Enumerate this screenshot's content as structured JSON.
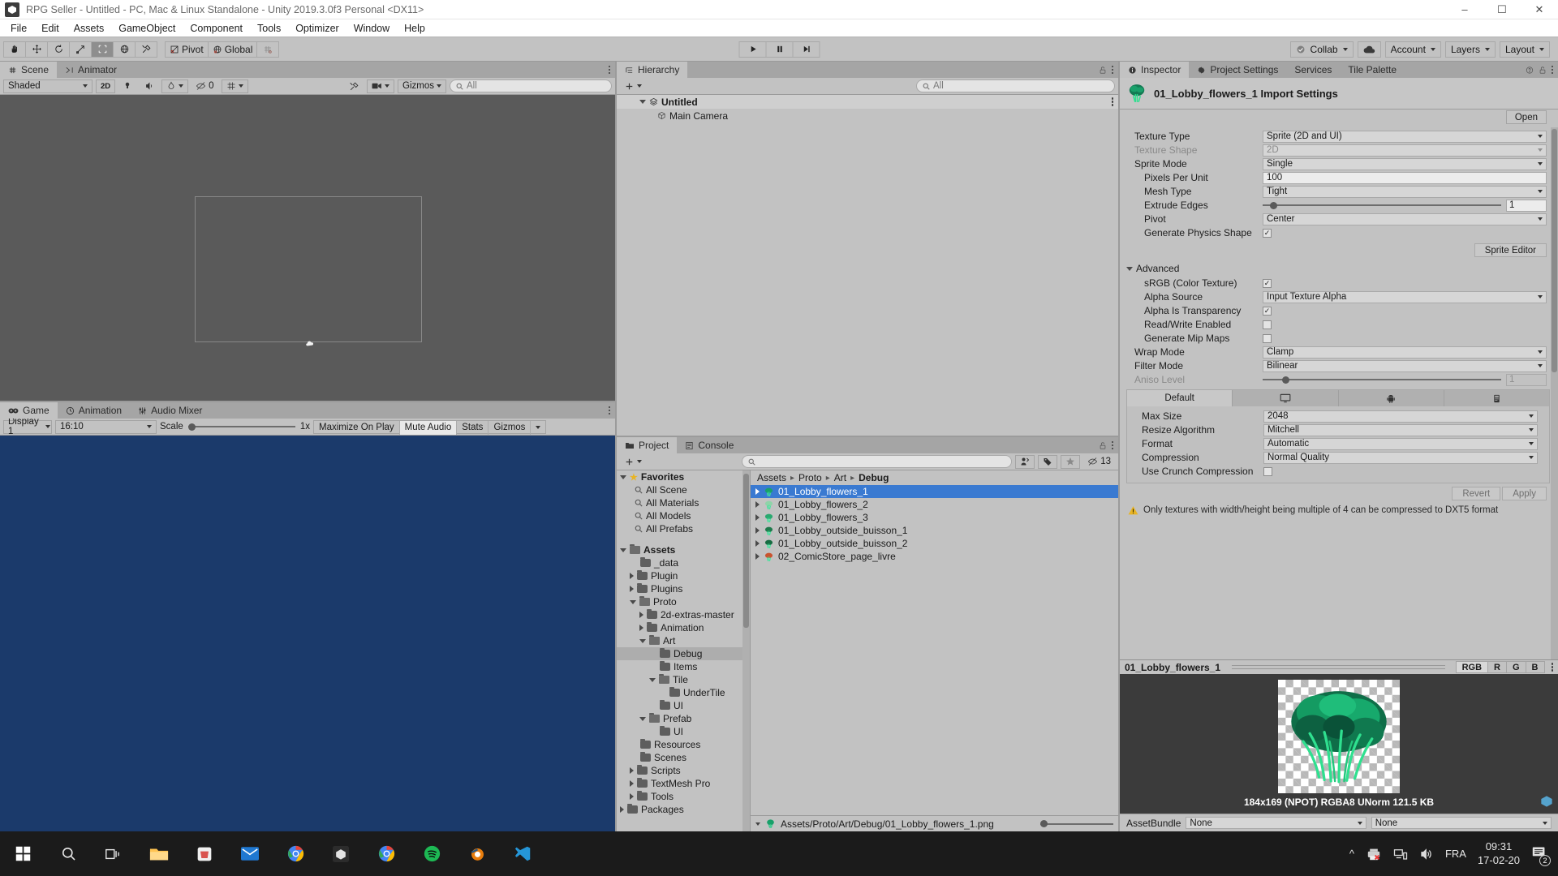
{
  "window": {
    "title": "RPG Seller - Untitled - PC, Mac & Linux Standalone - Unity 2019.3.0f3 Personal <DX11>",
    "minimize": "–",
    "maximize": "☐",
    "close": "✕"
  },
  "menubar": [
    "File",
    "Edit",
    "Assets",
    "GameObject",
    "Component",
    "Tools",
    "Optimizer",
    "Window",
    "Help"
  ],
  "toolbar": {
    "tools": [
      "hand-tool",
      "move-tool",
      "rotate-tool",
      "scale-tool",
      "rect-tool",
      "transform-tool",
      "custom-tool"
    ],
    "pivot_label": "Pivot",
    "global_label": "Global",
    "play": "▶",
    "pause": "❙❙",
    "step": "▶❙",
    "collab_label": "Collab",
    "account_label": "Account",
    "layers_label": "Layers",
    "layout_label": "Layout"
  },
  "scene": {
    "tabs": [
      {
        "label": "Scene",
        "icon": "grid-icon",
        "active": true
      },
      {
        "label": "Animator",
        "icon": "animator-icon",
        "active": false
      }
    ],
    "draw_mode": "Shaded",
    "mode_2d": "2D",
    "hidden_count": "0",
    "gizmos_label": "Gizmos",
    "search_placeholder": "All"
  },
  "game": {
    "tabs": [
      {
        "label": "Game",
        "icon": "game-icon",
        "active": true
      },
      {
        "label": "Animation",
        "icon": "clock-icon",
        "active": false
      },
      {
        "label": "Audio Mixer",
        "icon": "mixer-icon",
        "active": false
      }
    ],
    "display": "Display 1",
    "aspect": "16:10",
    "scale_label": "Scale",
    "scale_value": "1x",
    "maximize_label": "Maximize On Play",
    "mute_label": "Mute Audio",
    "stats_label": "Stats",
    "gizmos_label": "Gizmos"
  },
  "hierarchy": {
    "tab_label": "Hierarchy",
    "search_placeholder": "All",
    "items": [
      {
        "label": "Untitled",
        "type": "scene",
        "depth": 0
      },
      {
        "label": "Main Camera",
        "type": "gameobject",
        "depth": 1
      }
    ]
  },
  "project": {
    "tabs": [
      {
        "label": "Project",
        "icon": "folder-icon",
        "active": true
      },
      {
        "label": "Console",
        "icon": "console-icon",
        "active": false
      }
    ],
    "search_placeholder": "",
    "hidden_count": "13",
    "favorites_label": "Favorites",
    "favorites": [
      "All Scene",
      "All Materials",
      "All Models",
      "All Prefabs"
    ],
    "assets_label": "Assets",
    "tree": [
      {
        "label": "_data",
        "depth": 1,
        "arrow": "none",
        "open": false
      },
      {
        "label": "Plugin",
        "depth": 1,
        "arrow": "closed",
        "open": false
      },
      {
        "label": "Plugins",
        "depth": 1,
        "arrow": "closed",
        "open": false
      },
      {
        "label": "Proto",
        "depth": 1,
        "arrow": "open",
        "open": true
      },
      {
        "label": "2d-extras-master",
        "depth": 2,
        "arrow": "closed",
        "open": false
      },
      {
        "label": "Animation",
        "depth": 2,
        "arrow": "closed",
        "open": false
      },
      {
        "label": "Art",
        "depth": 2,
        "arrow": "open",
        "open": true
      },
      {
        "label": "Debug",
        "depth": 3,
        "arrow": "none",
        "open": false,
        "selected": true
      },
      {
        "label": "Items",
        "depth": 3,
        "arrow": "none",
        "open": false
      },
      {
        "label": "Tile",
        "depth": 3,
        "arrow": "open",
        "open": true
      },
      {
        "label": "UnderTile",
        "depth": 4,
        "arrow": "none",
        "open": false
      },
      {
        "label": "UI",
        "depth": 3,
        "arrow": "none",
        "open": false
      },
      {
        "label": "Prefab",
        "depth": 2,
        "arrow": "open",
        "open": true
      },
      {
        "label": "UI",
        "depth": 3,
        "arrow": "none",
        "open": false
      },
      {
        "label": "Resources",
        "depth": 1,
        "arrow": "none",
        "open": false
      },
      {
        "label": "Scenes",
        "depth": 1,
        "arrow": "none",
        "open": false
      },
      {
        "label": "Scripts",
        "depth": 1,
        "arrow": "closed",
        "open": false
      },
      {
        "label": "TextMesh Pro",
        "depth": 1,
        "arrow": "closed",
        "open": false
      },
      {
        "label": "Tools",
        "depth": 1,
        "arrow": "closed",
        "open": false
      },
      {
        "label": "Packages",
        "depth": 0,
        "arrow": "closed",
        "open": false
      }
    ],
    "breadcrumb": [
      "Assets",
      "Proto",
      "Art",
      "Debug"
    ],
    "files": [
      {
        "name": "01_Lobby_flowers_1",
        "selected": true
      },
      {
        "name": "01_Lobby_flowers_2",
        "selected": false
      },
      {
        "name": "01_Lobby_flowers_3",
        "selected": false
      },
      {
        "name": "01_Lobby_outside_buisson_1",
        "selected": false
      },
      {
        "name": "01_Lobby_outside_buisson_2",
        "selected": false
      },
      {
        "name": "02_ComicStore_page_livre",
        "selected": false
      }
    ],
    "status_path": "Assets/Proto/Art/Debug/01_Lobby_flowers_1.png"
  },
  "inspector": {
    "tabs": [
      {
        "label": "Inspector",
        "icon": "info-icon",
        "active": true
      },
      {
        "label": "Project Settings",
        "icon": "gear-icon",
        "active": false
      },
      {
        "label": "Services",
        "icon": "none",
        "active": false
      },
      {
        "label": "Tile Palette",
        "icon": "none",
        "active": false
      }
    ],
    "title": "01_Lobby_flowers_1 Import Settings",
    "open_label": "Open",
    "fields": [
      {
        "label": "Texture Type",
        "value": "Sprite (2D and UI)",
        "type": "dropdown",
        "indent": 0,
        "dim": false
      },
      {
        "label": "Texture Shape",
        "value": "2D",
        "type": "dropdown",
        "indent": 0,
        "dim": true
      },
      {
        "label": "Sprite Mode",
        "value": "Single",
        "type": "dropdown",
        "indent": 0,
        "dim": false
      },
      {
        "label": "Pixels Per Unit",
        "value": "100",
        "type": "input",
        "indent": 1,
        "dim": false
      },
      {
        "label": "Mesh Type",
        "value": "Tight",
        "type": "dropdown",
        "indent": 1,
        "dim": false
      },
      {
        "label": "Extrude Edges",
        "value": "1",
        "type": "slider",
        "indent": 1,
        "dim": false,
        "pct": 3
      },
      {
        "label": "Pivot",
        "value": "Center",
        "type": "dropdown",
        "indent": 1,
        "dim": false
      },
      {
        "label": "Generate Physics Shape",
        "value": "checked",
        "type": "checkbox",
        "indent": 1,
        "dim": false
      }
    ],
    "sprite_editor_label": "Sprite Editor",
    "advanced_label": "Advanced",
    "advanced_fields": [
      {
        "label": "sRGB (Color Texture)",
        "value": "checked",
        "type": "checkbox",
        "indent": 1,
        "dim": false
      },
      {
        "label": "Alpha Source",
        "value": "Input Texture Alpha",
        "type": "dropdown",
        "indent": 1,
        "dim": false
      },
      {
        "label": "Alpha Is Transparency",
        "value": "checked",
        "type": "checkbox",
        "indent": 1,
        "dim": false
      },
      {
        "label": "Read/Write Enabled",
        "value": "unchecked",
        "type": "checkbox",
        "indent": 1,
        "dim": false
      },
      {
        "label": "Generate Mip Maps",
        "value": "unchecked",
        "type": "checkbox",
        "indent": 1,
        "dim": false
      },
      {
        "label": "Wrap Mode",
        "value": "Clamp",
        "type": "dropdown",
        "indent": 0,
        "dim": false
      },
      {
        "label": "Filter Mode",
        "value": "Bilinear",
        "type": "dropdown",
        "indent": 0,
        "dim": false
      },
      {
        "label": "Aniso Level",
        "value": "1",
        "type": "slider",
        "indent": 0,
        "dim": true,
        "pct": 8
      }
    ],
    "platform_tabs": [
      {
        "label": "Default",
        "icon": "none",
        "active": true
      },
      {
        "label": "",
        "icon": "standalone-icon",
        "active": false
      },
      {
        "label": "",
        "icon": "android-icon",
        "active": false
      },
      {
        "label": "",
        "icon": "webgl-icon",
        "active": false
      }
    ],
    "platform_fields": [
      {
        "label": "Max Size",
        "value": "2048",
        "type": "dropdown"
      },
      {
        "label": "Resize Algorithm",
        "value": "Mitchell",
        "type": "dropdown"
      },
      {
        "label": "Format",
        "value": "Automatic",
        "type": "dropdown"
      },
      {
        "label": "Compression",
        "value": "Normal Quality",
        "type": "dropdown"
      },
      {
        "label": "Use Crunch Compression",
        "value": "unchecked",
        "type": "checkbox"
      }
    ],
    "revert_label": "Revert",
    "apply_label": "Apply",
    "warning": "Only textures with width/height being multiple of 4 can be compressed to DXT5 format",
    "preview_name": "01_Lobby_flowers_1",
    "channels": [
      "RGB",
      "R",
      "G",
      "B"
    ],
    "preview_caption": "184x169 (NPOT)  RGBA8 UNorm   121.5 KB",
    "assetbundle_label": "AssetBundle",
    "assetbundle_value": "None",
    "assetbundle_variant": "None"
  },
  "taskbar": {
    "start": "start-icon",
    "search": "search-icon",
    "taskview": "task-view-icon",
    "apps": [
      "explorer-icon",
      "store-icon",
      "mail-icon",
      "chrome-icon",
      "unity-hub-icon",
      "chrome2-icon",
      "spotify-icon",
      "blender-icon",
      "vscode-icon"
    ],
    "language": "FRA",
    "time": "09:31",
    "date": "17-02-20",
    "notification_count": "2"
  },
  "colors": {
    "accent_blue": "#3a7ad1",
    "panel_bg": "#c2c2c2",
    "tab_bg": "#a5a5a5",
    "scene_bg": "#5a5a5a",
    "game_bg": "#1b3a6b",
    "preview_bg": "#3b3b3b",
    "green": "#1f9d63"
  }
}
